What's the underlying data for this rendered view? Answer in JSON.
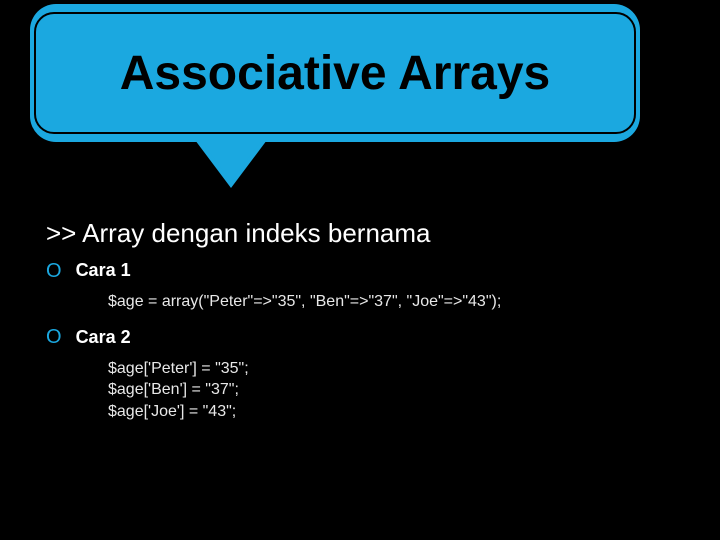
{
  "title": "Associative Arrays",
  "subtitle": ">> Array dengan indeks bernama",
  "sections": [
    {
      "label": "Cara 1",
      "code": [
        "$age = array(\"Peter\"=>\"35\", \"Ben\"=>\"37\", \"Joe\"=>\"43\");"
      ]
    },
    {
      "label": "Cara 2",
      "code": [
        "$age['Peter'] = \"35\";",
        "$age['Ben'] = \"37\";",
        "$age['Joe'] = \"43\";"
      ]
    }
  ],
  "bullet_glyph": "O"
}
